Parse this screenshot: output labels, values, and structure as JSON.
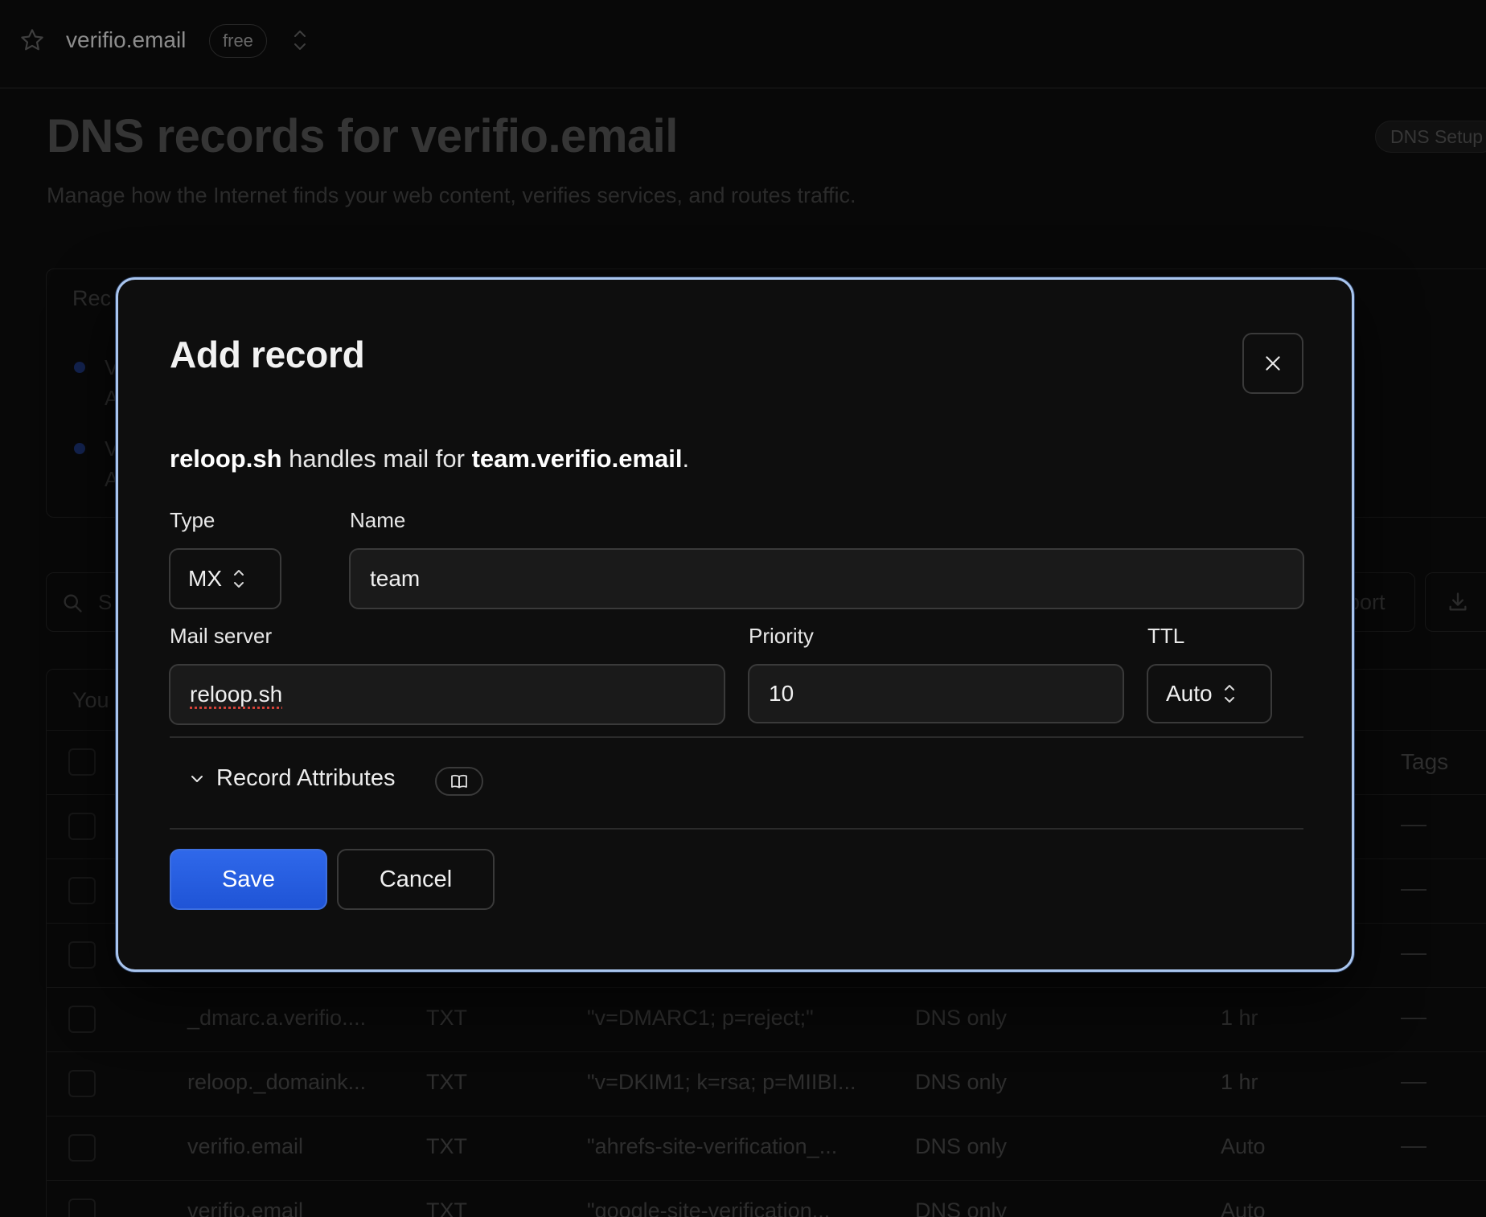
{
  "topbar": {
    "domain": "verifio.email",
    "plan": "free",
    "icons": {
      "favorite": "star-icon",
      "switch": "chevron-up-down-icon"
    }
  },
  "page": {
    "title": "DNS records for verifio.email",
    "subtitle": "Manage how the Internet finds your web content, verifies services, and routes traffic.",
    "dns_setup_badge": "DNS Setup"
  },
  "background": {
    "card_a_heading": "Rec",
    "card_a_items": [
      {
        "line1": "V",
        "line2": "A"
      },
      {
        "line1": "V",
        "line2": "A"
      }
    ],
    "search_placeholder": "S",
    "import_label": "port",
    "card_b_heading": "You",
    "tags_header": "Tags",
    "rows": [
      {
        "name": "_dmarc.a.verifio....",
        "type": "TXT",
        "content": "\"v=DMARC1; p=reject;\"",
        "proxy": "DNS only",
        "ttl": "1 hr"
      },
      {
        "name": "reloop._domaink...",
        "type": "TXT",
        "content": "\"v=DKIM1; k=rsa; p=MIIBI...",
        "proxy": "DNS only",
        "ttl": "1 hr"
      },
      {
        "name": "verifio.email",
        "type": "TXT",
        "content": "\"ahrefs-site-verification_...",
        "proxy": "DNS only",
        "ttl": "Auto"
      },
      {
        "name": "verifio.email",
        "type": "TXT",
        "content": "\"google-site-verification...",
        "proxy": "DNS only",
        "ttl": "Auto"
      }
    ]
  },
  "modal": {
    "title": "Add record",
    "description": {
      "provider": "reloop.sh",
      "middle": " handles mail for ",
      "host": "team.verifio.email",
      "end": "."
    },
    "type": {
      "label": "Type",
      "value": "MX"
    },
    "name": {
      "label": "Name",
      "value": "team"
    },
    "mail_server": {
      "label": "Mail server",
      "value": "reloop.sh"
    },
    "priority": {
      "label": "Priority",
      "value": "10"
    },
    "ttl": {
      "label": "TTL",
      "value": "Auto"
    },
    "attributes_label": "Record Attributes",
    "save_label": "Save",
    "cancel_label": "Cancel",
    "icons": {
      "close": "close-icon",
      "chevron": "chevron-down-icon",
      "docs": "book-icon",
      "stepper": "chevron-up-down-icon"
    }
  },
  "colors": {
    "accent": "#2f68ea",
    "modal_border": "#a9c5ee",
    "background": "#0b0b0b"
  }
}
